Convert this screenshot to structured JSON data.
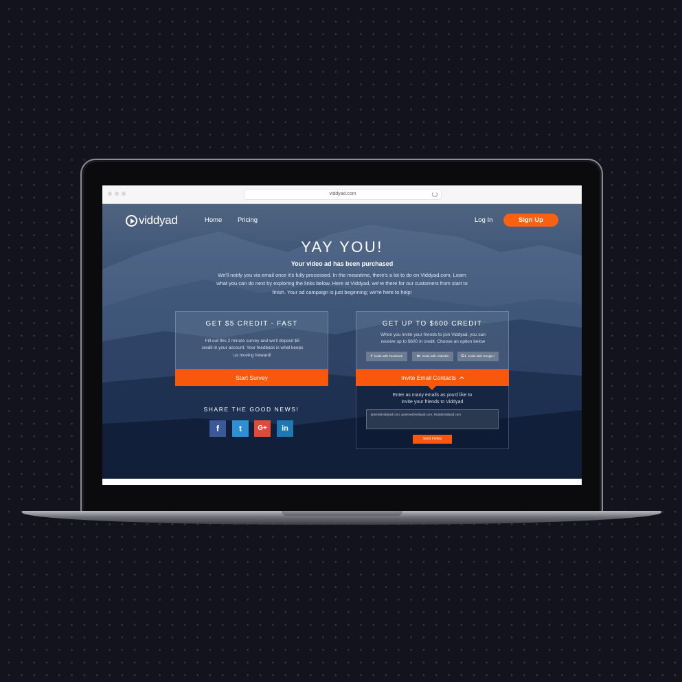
{
  "browser": {
    "url": "viddyad.com"
  },
  "nav": {
    "logo_text": "viddyad",
    "links": [
      "Home",
      "Pricing"
    ],
    "login": "Log In",
    "signup": "Sign Up"
  },
  "hero": {
    "title": "YAY YOU!",
    "subtitle": "Your video ad has been purchased",
    "body": "We'll notify you via email once it's fully processed. In the meantime, there's a lot to do on Viddyad.com. Learn what you can do next by exploring the links below. Here at Viddyad, we're there for our customers from start to finish. Your ad campaign is just beginning; we're here to help!"
  },
  "credit_card": {
    "title": "GET $5 CREDIT - FAST",
    "text": "Fill out this 2 minute survey and we'll deposit $5 credit in your account. Your feedback is what keeps us moving forward!",
    "button": "Start Survey"
  },
  "invite_card": {
    "title": "GET UP TO $600 CREDIT",
    "text": "When you invite your friends to join Viddyad, you can receive up to $600 in credit. Choose an option below",
    "buttons": [
      {
        "icon": "f",
        "label": "Invite with Facebook"
      },
      {
        "icon": "in",
        "label": "Invite with LinkedIn"
      },
      {
        "icon": "G+",
        "label": "Invite with Google+"
      }
    ],
    "bar_label": "Invite Email Contacts",
    "panel_text": "Enter as many emails as you'd like to invite your friends to Viddyad",
    "emails_value": "james@viddyad.com, grainne@viddyad.com, linda@viddyad.com",
    "send": "Send Invites"
  },
  "share": {
    "title": "SHARE THE GOOD NEWS!",
    "icons": [
      {
        "glyph": "f",
        "color": "#3b5998"
      },
      {
        "glyph": "t",
        "color": "#2f8fd2"
      },
      {
        "glyph": "G+",
        "color": "#dd4b39"
      },
      {
        "glyph": "in",
        "color": "#1f77b4"
      }
    ]
  }
}
